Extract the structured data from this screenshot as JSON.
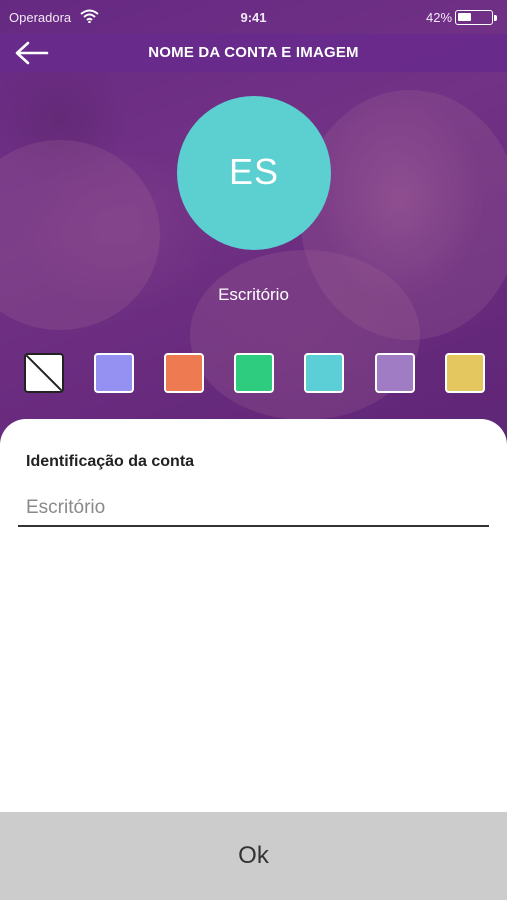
{
  "status_bar": {
    "carrier": "Operadora",
    "time": "9:41",
    "battery": "42%",
    "battery_level": 0.42,
    "wifi_icon": "wifi-icon",
    "battery_icon": "battery-icon"
  },
  "nav": {
    "back_icon": "arrow-left-icon",
    "title": "NOME DA CONTA E IMAGEM"
  },
  "avatar": {
    "initials": "ES",
    "color": "#5ccfd0"
  },
  "account_name": "Escritório",
  "swatches": {
    "colors": [
      "none",
      "#9491f2",
      "#ee7a52",
      "#2ecc7e",
      "#5ccfd6",
      "#a07cc4",
      "#e5c760"
    ]
  },
  "form": {
    "label": "Identificação da conta",
    "placeholder": "Escritório",
    "value": ""
  },
  "ok_button": {
    "label": "Ok"
  },
  "colors": {
    "accent": "#6a2d88",
    "avatar": "#5ccfd0",
    "button_bg": "#cccccc"
  }
}
